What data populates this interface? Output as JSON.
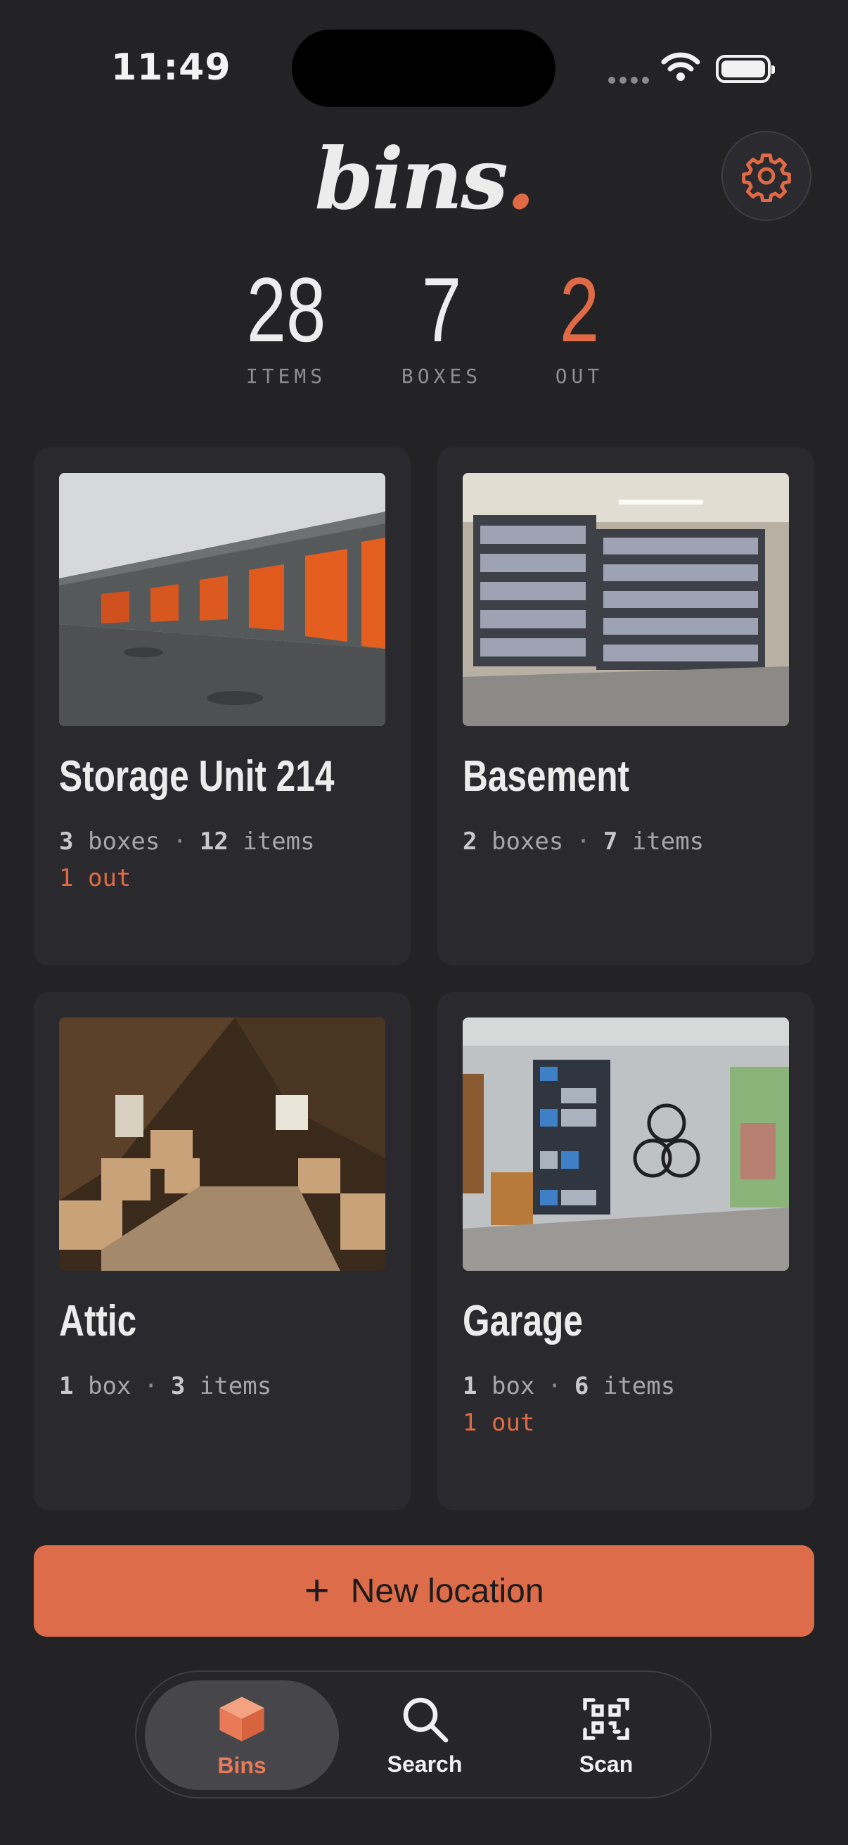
{
  "status_bar": {
    "time": "11:49"
  },
  "header": {
    "logo_text": "bins",
    "logo_dot": ".",
    "settings_icon": "gear-icon"
  },
  "stats": [
    {
      "value": "28",
      "label": "ITEMS"
    },
    {
      "value": "7",
      "label": "BOXES"
    },
    {
      "value": "2",
      "label": "OUT"
    }
  ],
  "locations": [
    {
      "name": "Storage Unit 214",
      "boxes_count": "3",
      "boxes_label": "boxes",
      "items_count": "12",
      "items_label": "items",
      "out_count": "1",
      "out_label": "out",
      "photo": "storage-unit-photo"
    },
    {
      "name": "Basement",
      "boxes_count": "2",
      "boxes_label": "boxes",
      "items_count": "7",
      "items_label": "items",
      "out_count": "",
      "out_label": "",
      "photo": "basement-photo"
    },
    {
      "name": "Attic",
      "boxes_count": "1",
      "boxes_label": "box",
      "items_count": "3",
      "items_label": "items",
      "out_count": "",
      "out_label": "",
      "photo": "attic-photo"
    },
    {
      "name": "Garage",
      "boxes_count": "1",
      "boxes_label": "box",
      "items_count": "6",
      "items_label": "items",
      "out_count": "1",
      "out_label": "out",
      "photo": "garage-photo"
    }
  ],
  "actions": {
    "new_location_label": "New location"
  },
  "tabbar": [
    {
      "label": "Bins",
      "icon": "box-icon",
      "active": true
    },
    {
      "label": "Search",
      "icon": "search-icon",
      "active": false
    },
    {
      "label": "Scan",
      "icon": "qr-scan-icon",
      "active": false
    }
  ],
  "colors": {
    "accent": "#e06a45",
    "background": "#232326",
    "card": "#2a2a2e"
  }
}
